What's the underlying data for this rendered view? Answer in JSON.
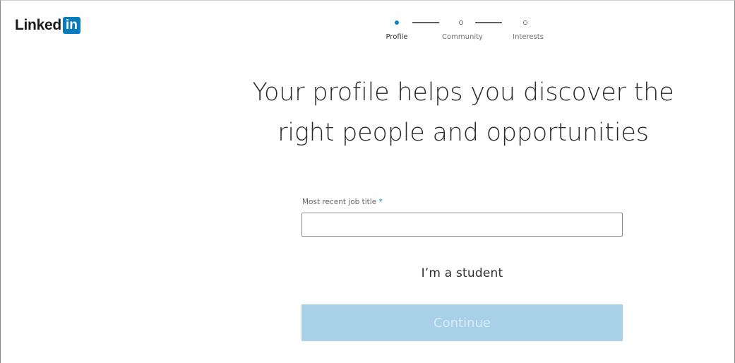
{
  "logo": {
    "word": "Linked",
    "box": "in",
    "brand_color": "#0a7cbd"
  },
  "stepper": {
    "active_color": "#0a84c6",
    "steps": [
      {
        "label": "Profile",
        "active": true
      },
      {
        "label": "Community",
        "active": false
      },
      {
        "label": "Interests",
        "active": false
      }
    ]
  },
  "headline": {
    "line1": "Your profile helps you discover the",
    "line2": "right people and opportunities"
  },
  "form": {
    "job_title_label": "Most recent job title",
    "required_marker": "*",
    "job_title_value": ""
  },
  "student_link": "I’m a student",
  "continue_button": {
    "label": "Continue",
    "disabled": true,
    "color": "#a8d0e6"
  }
}
